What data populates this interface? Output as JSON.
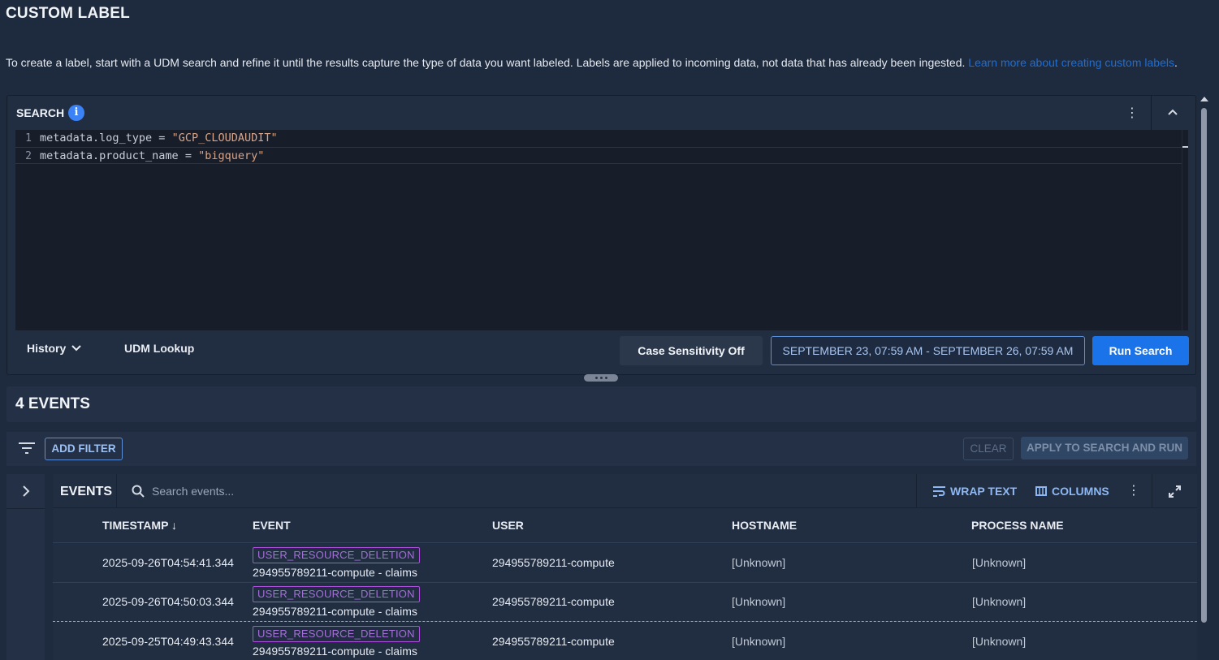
{
  "page": {
    "title": "CUSTOM LABEL",
    "intro_text": "To create a label, start with a UDM search and refine it until the results capture the type of data you want labeled. Labels are applied to incoming data, not data that has already been ingested. ",
    "intro_link": "Learn more about creating custom labels",
    "intro_end": "."
  },
  "search": {
    "title": "SEARCH",
    "info_icon": "info-icon",
    "menu_icon": "more-vert-icon",
    "collapse_icon": "chevron-up-icon",
    "editor_lines": [
      {
        "num": "1",
        "field": "metadata.log_type",
        "op": " = ",
        "value": "\"GCP_CLOUDAUDIT\""
      },
      {
        "num": "2",
        "field": "metadata.product_name",
        "op": " = ",
        "value": "\"bigquery\""
      }
    ],
    "history_label": "History",
    "udm_lookup_label": "UDM Lookup",
    "case_sensitivity_label": "Case Sensitivity Off",
    "date_range_label": "SEPTEMBER 23, 07:59 AM - SEPTEMBER 26, 07:59 AM",
    "run_label": "Run Search"
  },
  "events": {
    "count_label": "4 EVENTS",
    "add_filter_label": "ADD FILTER",
    "clear_label": "CLEAR",
    "apply_label": "APPLY TO SEARCH AND RUN",
    "table_title": "EVENTS",
    "search_placeholder": "Search events...",
    "wrap_text_label": "WRAP TEXT",
    "columns_label": "COLUMNS",
    "columns": [
      "TIMESTAMP ↓",
      "EVENT",
      "USER",
      "HOSTNAME",
      "PROCESS NAME"
    ],
    "rows": [
      {
        "timestamp": "2025-09-26T04:54:41.344",
        "event_type": "USER_RESOURCE_DELETION",
        "event_desc": "294955789211-compute - claims",
        "user": "294955789211-compute",
        "hostname": "[Unknown]",
        "process": "[Unknown]"
      },
      {
        "timestamp": "2025-09-26T04:50:03.344",
        "event_type": "USER_RESOURCE_DELETION",
        "event_desc": "294955789211-compute - claims",
        "user": "294955789211-compute",
        "hostname": "[Unknown]",
        "process": "[Unknown]"
      },
      {
        "timestamp": "2025-09-25T04:49:43.344",
        "event_type": "USER_RESOURCE_DELETION",
        "event_desc": "294955789211-compute - claims",
        "user": "294955789211-compute",
        "hostname": "[Unknown]",
        "process": "[Unknown]"
      }
    ]
  },
  "colors": {
    "background": "#1e2a3d",
    "accent": "#1a73e8",
    "event_badge": "#b04ee0",
    "link": "#1f6ed4"
  }
}
